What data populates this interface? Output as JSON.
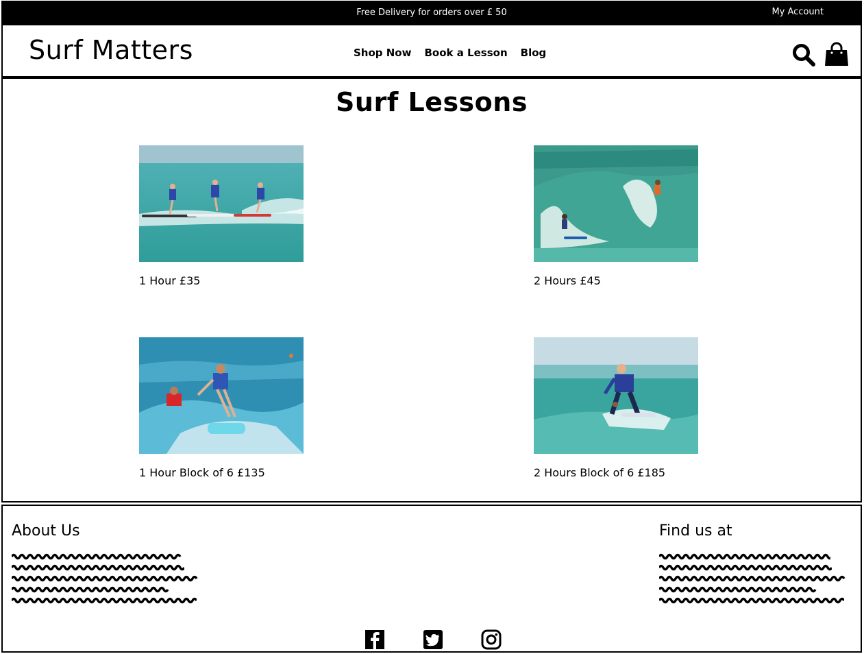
{
  "topbar": {
    "promo": "Free Delivery for orders over £ 50",
    "account": "My Account"
  },
  "header": {
    "logo": "Surf Matters",
    "nav": [
      "Shop Now",
      "Book a Lesson",
      "Blog"
    ],
    "icons": [
      "search-icon",
      "shopping-bag-icon"
    ]
  },
  "main": {
    "title": "Surf Lessons",
    "lessons": [
      {
        "label": "1 Hour £35"
      },
      {
        "label": "2 Hours £45"
      },
      {
        "label": "1 Hour Block of 6 £135"
      },
      {
        "label": "2 Hours Block of 6 £185"
      }
    ]
  },
  "footer": {
    "about_title": "About Us",
    "find_title": "Find us at",
    "social": [
      "facebook-icon",
      "twitter-icon",
      "instagram-icon"
    ]
  },
  "colors": {
    "topbar_bg": "#000000",
    "topbar_text": "#ffffff",
    "page_bg": "#ffffff",
    "ocean": "#3aa8a8",
    "sky": "#b9d4df"
  }
}
